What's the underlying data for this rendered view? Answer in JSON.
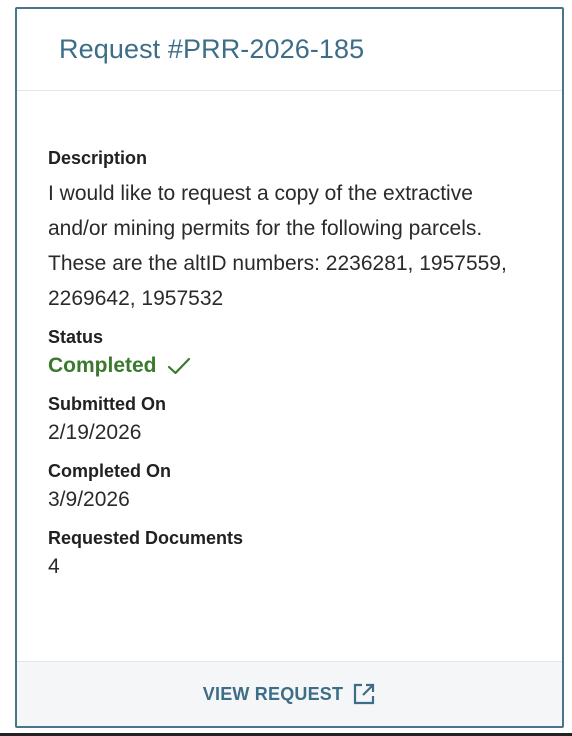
{
  "request": {
    "title": "Request #PRR-2026-185"
  },
  "fields": {
    "description": {
      "label": "Description",
      "value": "I would like to request a copy of the extractive and/or mining permits for the following parcels. These are the altID numbers: 2236281, 1957559, 2269642, 1957532"
    },
    "status": {
      "label": "Status",
      "value": "Completed",
      "icon": "check-icon",
      "color": "#3b7a2e"
    },
    "submitted_on": {
      "label": "Submitted On",
      "value": "2/19/2026"
    },
    "completed_on": {
      "label": "Completed On",
      "value": "3/9/2026"
    },
    "requested_documents": {
      "label": "Requested Documents",
      "value": "4"
    }
  },
  "footer": {
    "view_request_label": "VIEW REQUEST",
    "icon": "external-link-icon"
  },
  "colors": {
    "accent": "#3e6e87",
    "border": "#4a7489",
    "success": "#3b7a2e"
  }
}
